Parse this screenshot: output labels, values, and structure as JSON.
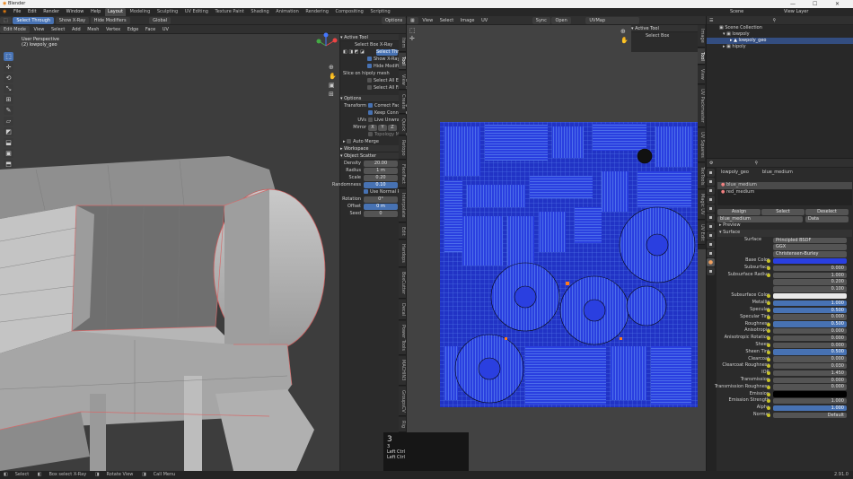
{
  "app": {
    "title": "Blender",
    "min": "—",
    "max": "☐",
    "close": "✕"
  },
  "menu": {
    "items": [
      "File",
      "Edit",
      "Render",
      "Window",
      "Help"
    ],
    "tabs": [
      "Layout",
      "Modeling",
      "Sculpting",
      "UV Editing",
      "Texture Paint",
      "Shading",
      "Animation",
      "Rendering",
      "Compositing",
      "Scripting"
    ],
    "active_tab": "Layout",
    "scene": "Scene",
    "view_layer": "View Layer"
  },
  "viewport": {
    "header_tools": [
      "Select Through",
      "Show X-Ray",
      "Hide Modifiers"
    ],
    "mode": "Edit Mode",
    "menus": [
      "View",
      "Select",
      "Add",
      "Mesh",
      "Vertex",
      "Edge",
      "Face",
      "UV"
    ],
    "transform": "Global",
    "options": "Options",
    "overlay_line1": "User Perspective",
    "overlay_line2": "(2) lowpoly_geo",
    "tools": [
      "⬚",
      "✛",
      "⟲",
      "⤡",
      "⊞",
      "✎",
      "▱",
      "◩",
      "⬓",
      "▣",
      "⬒",
      "◧",
      "⬔",
      "⬕",
      "⟳",
      "⇲",
      "◆",
      "◍",
      "✂",
      "⊟",
      "✥",
      "⬘",
      "◫",
      "▦"
    ]
  },
  "npanel": {
    "active_tool": "Active Tool",
    "tool_name": "Select Box X-Ray",
    "mode_label": "Select Thr",
    "show_xray": "Show X-Ray",
    "hide_modifiers": "Hide Modifiers",
    "slice_text": "Slice on hipoly mesh",
    "select_all_edges": "Select All Edges",
    "select_all_faces": "Select All Faces",
    "options": "Options",
    "transform_label": "Transform",
    "correct_face": "Correct Face Att",
    "keep_connected": "Keep Connected",
    "uvs_label": "UVs",
    "live_unwrap": "Live Unwrap",
    "mirror_label": "Mirror",
    "mirror_axes": [
      "X",
      "Y",
      "Z"
    ],
    "topology_mirror": "Topology Mirror",
    "auto_merge": "Auto Merge",
    "workspace": "Workspace",
    "object_scatter": "Object Scatter",
    "density_label": "Density",
    "density_val": "20.00",
    "radius_label": "Radius",
    "radius_val": "1 m",
    "scale_label": "Scale",
    "scale_val": "0.20",
    "randomness_label": "Randomness",
    "randomness_val": "0.10",
    "use_normal": "Use Normal Ro",
    "rotation_label": "Rotation",
    "rotation_val": "0°",
    "offset_label": "Offset",
    "offset_val": "0 m",
    "seed_label": "Seed",
    "seed_val": "0",
    "vtabs": [
      "Item",
      "Tool",
      "View",
      "Create",
      "Quick",
      "Retopo",
      "FlexiFact",
      "Interpolate",
      "Edit",
      "Hardops",
      "BoxCutter",
      "Decal",
      "Power Tools",
      "MACHIN3",
      "GroupsCV",
      "Rig",
      "Object"
    ]
  },
  "uv_editor": {
    "mode": "UV Editor",
    "menus": [
      "View",
      "Select",
      "Image",
      "UV"
    ],
    "sync_label": "Sync",
    "snap_label": "Open",
    "image_name": "UVMap",
    "active_tool": "Active Tool",
    "tool_name": "Select Box",
    "vtabs": [
      "Image",
      "Tool",
      "View",
      "UV Packmaster",
      "UV Squares",
      "TexTools",
      "Magic UV",
      "UV Edit"
    ]
  },
  "outliner": {
    "title": "Scene Collection",
    "rows": [
      "Scene Collection",
      "lowpoly",
      "lowpoly_geo",
      "hipoly"
    ]
  },
  "properties": {
    "breadcrumb1": "lowpoly_geo",
    "breadcrumb2": "blue_medium",
    "slots": [
      "blue_medium",
      "red_medium"
    ],
    "material_name": "blue_medium",
    "assign": "Assign",
    "select": "Select",
    "deselect": "Deselect",
    "preview": "Preview",
    "data_label": "Data",
    "surface_section": "Surface",
    "surface_label": "Surface",
    "surface_val": "Principled BSDF",
    "ggx": "GGX",
    "christensen": "Christensen-Burley",
    "rows": [
      {
        "label": "Base Color",
        "value": "",
        "blue": true
      },
      {
        "label": "Subsurface",
        "value": "0.000",
        "blue": false
      },
      {
        "label": "Subsurface Radius",
        "value": "1.000",
        "blue": false
      },
      {
        "label": "",
        "value": "0.200",
        "blue": false
      },
      {
        "label": "",
        "value": "0.100",
        "blue": false
      },
      {
        "label": "Subsurface Color",
        "value": "",
        "blue": false
      },
      {
        "label": "Metallic",
        "value": "1.000",
        "blue": true
      },
      {
        "label": "Specular",
        "value": "0.500",
        "blue": true
      },
      {
        "label": "Specular Tint",
        "value": "0.000",
        "blue": false
      },
      {
        "label": "Roughness",
        "value": "0.500",
        "blue": true
      },
      {
        "label": "Anisotropic",
        "value": "0.000",
        "blue": false
      },
      {
        "label": "Anisotropic Rotation",
        "value": "0.000",
        "blue": false
      },
      {
        "label": "Sheen",
        "value": "0.000",
        "blue": false
      },
      {
        "label": "Sheen Tint",
        "value": "0.500",
        "blue": true
      },
      {
        "label": "Clearcoat",
        "value": "0.000",
        "blue": false
      },
      {
        "label": "Clearcoat Roughness",
        "value": "0.030",
        "blue": false
      },
      {
        "label": "IOR",
        "value": "1.450",
        "blue": false
      },
      {
        "label": "Transmission",
        "value": "0.000",
        "blue": false
      },
      {
        "label": "Transmission Roughness",
        "value": "0.000",
        "blue": false
      },
      {
        "label": "Emission",
        "value": "",
        "blue": false
      },
      {
        "label": "Emission Strength",
        "value": "1.000",
        "blue": false
      },
      {
        "label": "Alpha",
        "value": "1.000",
        "blue": true
      },
      {
        "label": "Normal",
        "value": "Default",
        "blue": false
      }
    ]
  },
  "keypress": {
    "line1": "3",
    "line2": "3",
    "line3": "Left Ctrl",
    "line4": "Left Ctrl"
  },
  "status": {
    "items": [
      "Select",
      "Box select X-Ray",
      "Rotate View",
      "Call Menu"
    ],
    "version": "2.91.0"
  }
}
